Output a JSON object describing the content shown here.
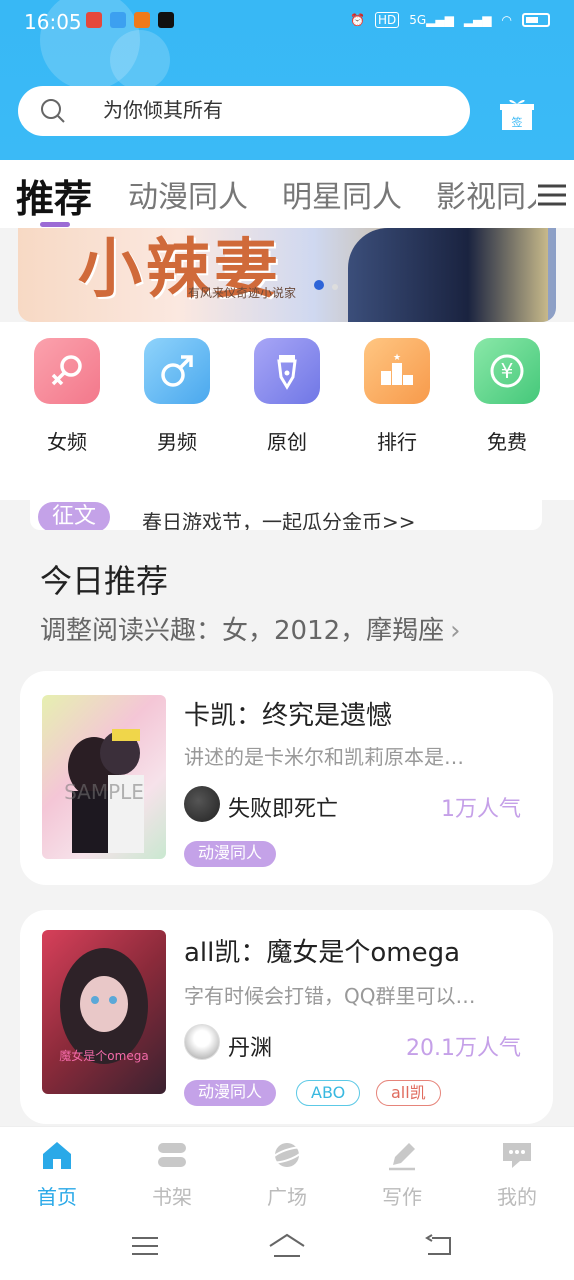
{
  "status_bar": {
    "time": "16:05",
    "battery_icon": "battery-icon"
  },
  "search": {
    "placeholder": "为你倾其所有",
    "gift_label": "签"
  },
  "tabs": [
    {
      "label": "推荐",
      "active": true
    },
    {
      "label": "动漫同人"
    },
    {
      "label": "明星同人"
    },
    {
      "label": "影视同人"
    }
  ],
  "banner": {
    "title": "小辣妻",
    "subtitle": "有风来仪奇迹小说家"
  },
  "categories": [
    {
      "label": "女频",
      "icon": "female-icon",
      "color": "#f58d9a"
    },
    {
      "label": "男频",
      "icon": "male-icon",
      "color": "#5bb9f2"
    },
    {
      "label": "原创",
      "icon": "pen-icon",
      "color": "#8a8ef0"
    },
    {
      "label": "排行",
      "icon": "ranking-icon",
      "color": "#f8a95a"
    },
    {
      "label": "免费",
      "icon": "yen-icon",
      "color": "#5cd58c"
    }
  ],
  "notice": {
    "tag": "征文",
    "text": "春日游戏节，一起瓜分金币>>"
  },
  "section": {
    "title": "今日推荐",
    "subtitle": "调整阅读兴趣：女，2012，摩羯座"
  },
  "books": [
    {
      "title": "卡凯：终究是遗憾",
      "desc": "讲述的是卡米尔和凯莉原本是…",
      "author": "失败即死亡",
      "popularity": "1万人气",
      "tags": [
        {
          "label": "动漫同人",
          "style": "purple"
        }
      ],
      "cover_text": "SAMPLE"
    },
    {
      "title": "all凯：魔女是个omega",
      "desc": "字有时候会打错，QQ群里可以…",
      "author": "丹渊",
      "popularity": "20.1万人气",
      "tags": [
        {
          "label": "动漫同人",
          "style": "purple"
        },
        {
          "label": "ABO",
          "style": "cyan"
        },
        {
          "label": "all凯",
          "style": "red"
        }
      ],
      "cover_text": "魔女是个omega"
    }
  ],
  "bottom_nav": [
    {
      "label": "首页",
      "icon": "home-icon",
      "active": true
    },
    {
      "label": "书架",
      "icon": "bookshelf-icon"
    },
    {
      "label": "广场",
      "icon": "planet-icon"
    },
    {
      "label": "写作",
      "icon": "write-icon"
    },
    {
      "label": "我的",
      "icon": "profile-icon"
    }
  ]
}
